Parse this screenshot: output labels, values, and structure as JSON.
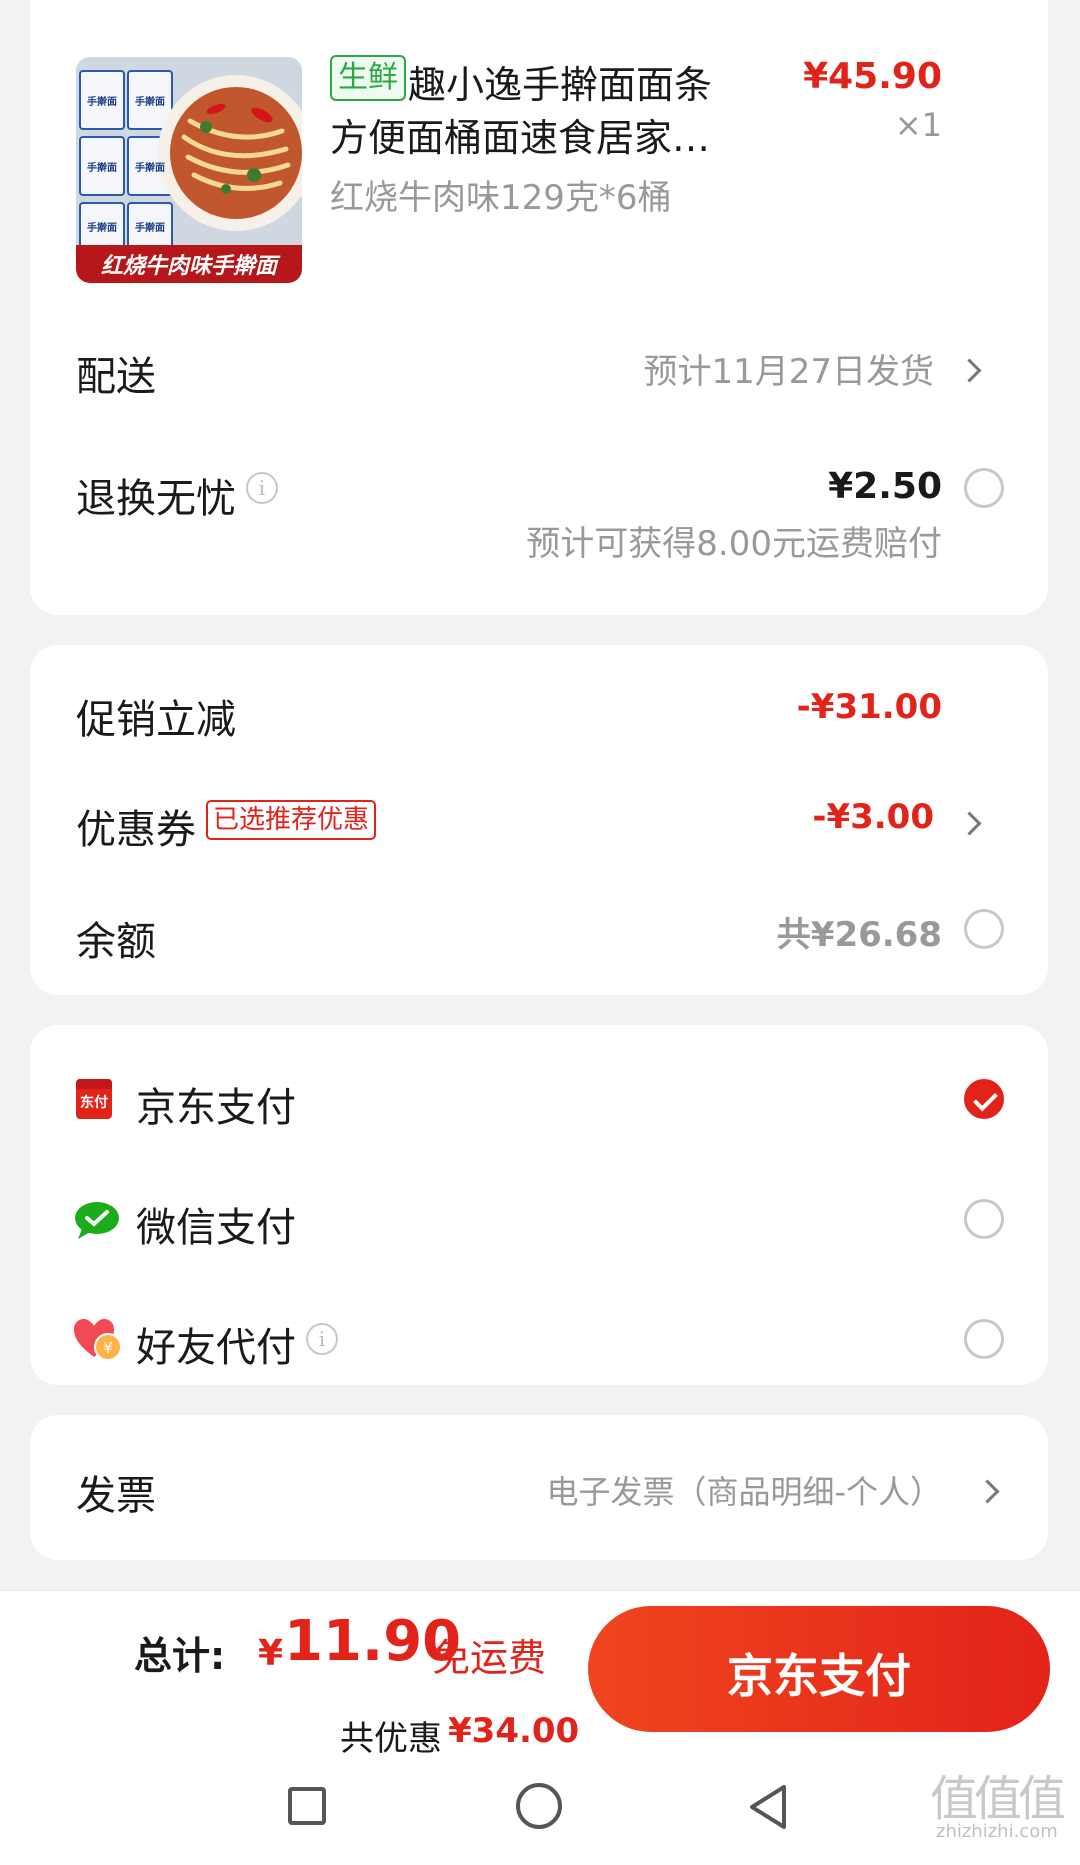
{
  "product": {
    "badge": "生鲜",
    "title_line1": "趣小逸手擀面面条",
    "title_line2": "方便面桶面速食居家…",
    "spec": "红烧牛肉味129克*6桶",
    "price": "¥45.90",
    "qty": "×1",
    "image_tag": "红烧牛肉味手擀面",
    "package_labels": [
      "手擀面",
      "手擀面",
      "手擀面",
      "手擀面",
      "手擀面",
      "手擀面"
    ]
  },
  "delivery": {
    "label": "配送",
    "value": "预计11月27日发货"
  },
  "return_ins": {
    "label": "退换无忧",
    "price": "¥2.50",
    "note": "预计可获得8.00元运费赔付"
  },
  "discounts": {
    "promo_label": "促销立减",
    "promo_value": "-¥31.00",
    "coupon_label": "优惠券",
    "coupon_badge": "已选推荐优惠",
    "coupon_value": "-¥3.00",
    "balance_label": "余额",
    "balance_value": "共¥26.68"
  },
  "payment": {
    "methods": [
      {
        "icon": "jd-pay-icon",
        "icon_text": "东付",
        "label": "京东支付",
        "selected": true
      },
      {
        "icon": "wechat-icon",
        "label": "微信支付",
        "selected": false
      },
      {
        "icon": "friend-pay-icon",
        "label": "好友代付",
        "selected": false
      }
    ]
  },
  "invoice": {
    "label": "发票",
    "value": "电子发票（商品明细-个人）"
  },
  "total": {
    "label": "总计:",
    "currency": "¥",
    "amount": "11.90",
    "shipping": "免运费",
    "saved_label": "共优惠",
    "saved_value": "¥34.00",
    "pay_button": "京东支付"
  },
  "watermark": {
    "text": "值值值",
    "site": "zhizhizhi.com"
  },
  "colors": {
    "accent": "#e2231a",
    "fresh_green": "#2aa845",
    "wechat_green": "#1aad19"
  }
}
